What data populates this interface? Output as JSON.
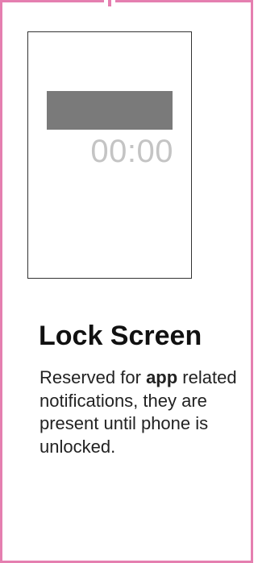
{
  "lock_screen": {
    "clock_time": "00:00",
    "title": "Lock Screen",
    "description_before": "Reserved for ",
    "description_bold": "app",
    "description_after": " related notifications, they are present until phone is unlocked."
  },
  "colors": {
    "card_border": "#e57fb0",
    "notification_bar": "#7a7a7a",
    "clock_text": "#c4c4c4",
    "phone_frame_border": "#333333"
  }
}
